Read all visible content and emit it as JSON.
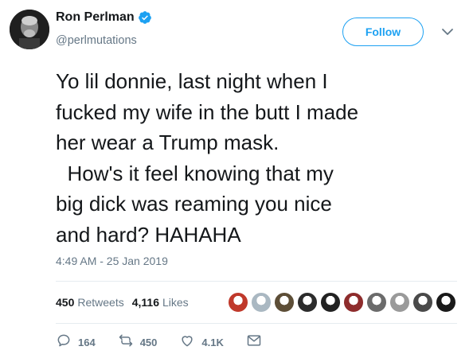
{
  "user": {
    "display_name": "Ron Perlman",
    "handle": "@perlmutations",
    "verified": true
  },
  "follow_button": {
    "label": "Follow"
  },
  "tweet": {
    "text": "Yo lil donnie, last night when I\nfucked my wife in the butt I made\nher wear a Trump mask.\n  How's it feel knowing that my\nbig dick was reaming you nice\nand hard? HAHAHA",
    "timestamp": "4:49 AM - 25 Jan 2019"
  },
  "stats": {
    "retweets_count": "450",
    "retweets_label": "Retweets",
    "likes_count": "4,116",
    "likes_label": "Likes"
  },
  "liker_avatars": [
    {
      "color": "#c0392b"
    },
    {
      "color": "#aab8c2"
    },
    {
      "color": "#5d4e37"
    },
    {
      "color": "#2c2c2c"
    },
    {
      "color": "#222222"
    },
    {
      "color": "#8e2c2c"
    },
    {
      "color": "#6b6b6b"
    },
    {
      "color": "#9a9a9a"
    },
    {
      "color": "#4a4a4a"
    },
    {
      "color": "#1a1a1a"
    }
  ],
  "actions": {
    "reply_count": "164",
    "retweet_count": "450",
    "like_count": "4.1K"
  },
  "colors": {
    "accent": "#1da1f2",
    "text": "#14171a",
    "muted": "#657786",
    "divider": "#e6ecf0"
  },
  "icons": {
    "verified": "verified-badge-icon",
    "caret": "chevron-down-icon",
    "reply": "reply-icon",
    "retweet": "retweet-icon",
    "like": "heart-icon",
    "dm": "envelope-icon"
  }
}
